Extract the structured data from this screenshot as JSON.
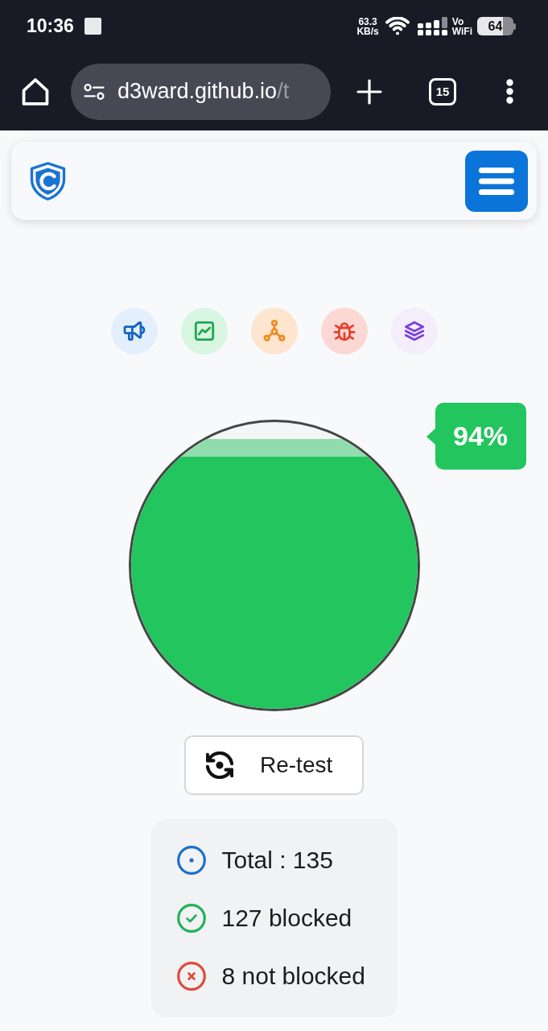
{
  "status_bar": {
    "time": "10:36",
    "net_speed": "63.3",
    "net_unit": "KB/s",
    "volte_top": "Vo",
    "volte_bottom": "WiFi",
    "battery": "64"
  },
  "browser": {
    "url_host": "d3ward.github.io",
    "url_path": "/t",
    "tab_count": "15"
  },
  "gauge": {
    "level": 0.94,
    "percent": "94%"
  },
  "retest_button": {
    "label": "Re-test"
  },
  "stats": [
    {
      "kind": "total",
      "text": "Total : 135"
    },
    {
      "kind": "blocked",
      "text": "127 blocked"
    },
    {
      "kind": "not_blocked",
      "text": "8 not blocked"
    }
  ]
}
